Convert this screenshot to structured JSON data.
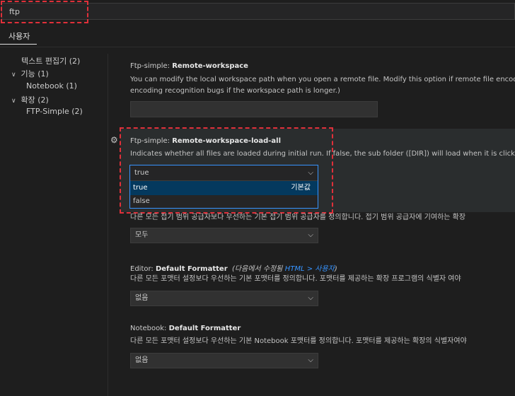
{
  "search": {
    "value": "ftp"
  },
  "tabs": {
    "user": "사용자"
  },
  "toc": [
    {
      "label": "텍스트 편집기 (2)"
    },
    {
      "label": "기능 (1)"
    },
    {
      "label": "Notebook (1)"
    },
    {
      "label": "확장 (2)"
    },
    {
      "label": "FTP-Simple (2)"
    }
  ],
  "settings": {
    "remote_workspace": {
      "category": "Ftp-simple: ",
      "name": "Remote-workspace",
      "desc1": "You can modify the local workspace path when you open a remote file. Modify this option if remote file encoding is",
      "desc2": "encoding recognition bugs if the workspace path is longer.)",
      "value": ""
    },
    "load_all": {
      "category": "Ftp-simple: ",
      "name": "Remote-workspace-load-all",
      "desc": "Indicates whether all files are loaded during initial run. If false, the sub folder ([DIR]) will load when it is clicked. Def",
      "selected": "true",
      "options": [
        "true",
        "false"
      ],
      "default_label": "기본값"
    },
    "folding": {
      "desc": "다른 모든 접기 범위 공급자보다 우선하는 기본 접기 범위 공급자를 정의합니다. 접기 범위 공급자에 기여하는 확장",
      "value": "모두"
    },
    "editor_formatter": {
      "category": "Editor: ",
      "name": "Default Formatter",
      "modified_prefix": "(다음에서 수정됨 ",
      "modified_link": "HTML > 사용자",
      "modified_suffix": ")",
      "desc": "다른 모든 포맷터 설정보다 우선하는 기본 포맷터를 정의합니다. 포맷터를 제공하는 확장 프로그램의 식별자 여야",
      "value": "없음"
    },
    "notebook_formatter": {
      "category": "Notebook: ",
      "name": "Default Formatter",
      "desc": "다른 모든 포맷터 설정보다 우선하는 기본 Notebook 포맷터를 정의합니다. 포맷터를 제공하는 확장의 식별자여야",
      "value": "없음"
    }
  },
  "colors": {
    "highlight": "#e0303a",
    "focus_border": "#3794ff",
    "selected_option": "#04395e"
  }
}
